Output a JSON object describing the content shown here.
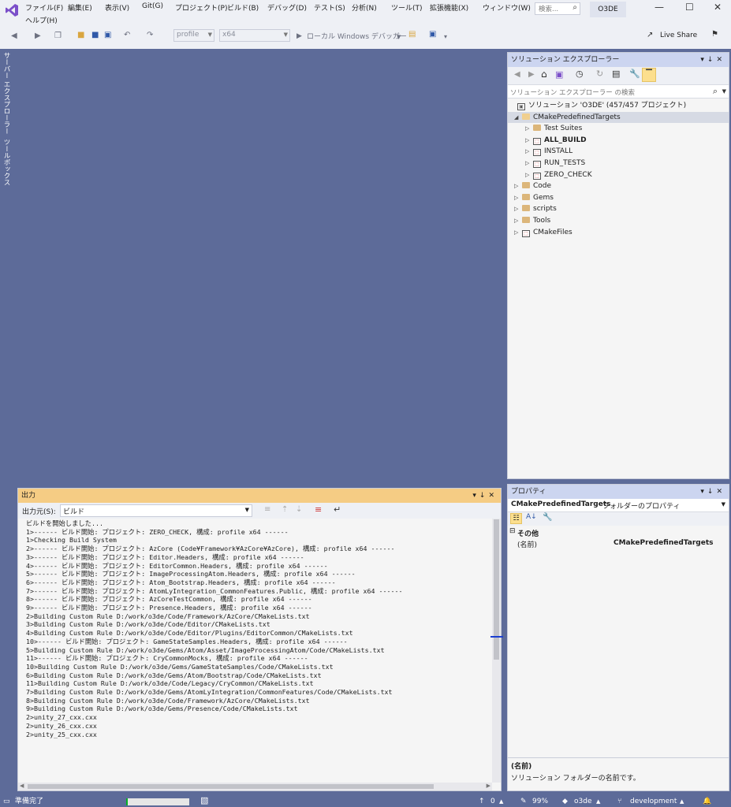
{
  "menu": [
    "ファイル(F)",
    "編集(E)",
    "表示(V)",
    "Git(G)",
    "プロジェクト(P)",
    "ビルド(B)",
    "デバッグ(D)",
    "テスト(S)",
    "分析(N)",
    "ツール(T)",
    "拡張機能(X)",
    "ウィンドウ(W)",
    "ヘルプ(H)"
  ],
  "search_placeholder": "検索...",
  "solution_badge": "O3DE",
  "toolbar": {
    "config": "profile",
    "platform": "x64",
    "run_label": "ローカル Windows デバッガー",
    "live_share": "Live Share"
  },
  "side_tabs": "サーバー エクスプローラー  ツールボックス",
  "solution_explorer": {
    "title": "ソリューション エクスプローラー",
    "search_placeholder": "ソリューション エクスプローラー の検索",
    "root": "ソリューション 'O3DE' (457/457 プロジェクト)",
    "items": [
      {
        "label": "CMakePredefinedTargets",
        "level": 1,
        "kind": "folder",
        "expanded": true,
        "selected": true
      },
      {
        "label": "Test Suites",
        "level": 2,
        "kind": "folder"
      },
      {
        "label": "ALL_BUILD",
        "level": 2,
        "kind": "project",
        "bold": true
      },
      {
        "label": "INSTALL",
        "level": 2,
        "kind": "project"
      },
      {
        "label": "RUN_TESTS",
        "level": 2,
        "kind": "project"
      },
      {
        "label": "ZERO_CHECK",
        "level": 2,
        "kind": "project"
      },
      {
        "label": "Code",
        "level": 1,
        "kind": "folder"
      },
      {
        "label": "Gems",
        "level": 1,
        "kind": "folder"
      },
      {
        "label": "scripts",
        "level": 1,
        "kind": "folder"
      },
      {
        "label": "Tools",
        "level": 1,
        "kind": "folder"
      },
      {
        "label": "CMakeFiles",
        "level": 1,
        "kind": "project"
      }
    ]
  },
  "output": {
    "title": "出力",
    "source_label": "出力元(S):",
    "source_value": "ビルド",
    "lines": [
      "ビルドを開始しました...",
      "1>------ ビルド開始: プロジェクト: ZERO_CHECK, 構成: profile x64 ------",
      "1>Checking Build System",
      "2>------ ビルド開始: プロジェクト: AzCore (Code¥Framework¥AzCore¥AzCore), 構成: profile x64 ------",
      "3>------ ビルド開始: プロジェクト: Editor.Headers, 構成: profile x64 ------",
      "4>------ ビルド開始: プロジェクト: EditorCommon.Headers, 構成: profile x64 ------",
      "5>------ ビルド開始: プロジェクト: ImageProcessingAtom.Headers, 構成: profile x64 ------",
      "6>------ ビルド開始: プロジェクト: Atom_Bootstrap.Headers, 構成: profile x64 ------",
      "7>------ ビルド開始: プロジェクト: AtomLyIntegration_CommonFeatures.Public, 構成: profile x64 ------",
      "8>------ ビルド開始: プロジェクト: AzCoreTestCommon, 構成: profile x64 ------",
      "9>------ ビルド開始: プロジェクト: Presence.Headers, 構成: profile x64 ------",
      "2>Building Custom Rule D:/work/o3de/Code/Framework/AzCore/CMakeLists.txt",
      "3>Building Custom Rule D:/work/o3de/Code/Editor/CMakeLists.txt",
      "4>Building Custom Rule D:/work/o3de/Code/Editor/Plugins/EditorCommon/CMakeLists.txt",
      "10>------ ビルド開始: プロジェクト: GameStateSamples.Headers, 構成: profile x64 ------",
      "5>Building Custom Rule D:/work/o3de/Gems/Atom/Asset/ImageProcessingAtom/Code/CMakeLists.txt",
      "11>------ ビルド開始: プロジェクト: CryCommonMocks, 構成: profile x64 ------",
      "10>Building Custom Rule D:/work/o3de/Gems/GameStateSamples/Code/CMakeLists.txt",
      "6>Building Custom Rule D:/work/o3de/Gems/Atom/Bootstrap/Code/CMakeLists.txt",
      "11>Building Custom Rule D:/work/o3de/Code/Legacy/CryCommon/CMakeLists.txt",
      "7>Building Custom Rule D:/work/o3de/Gems/AtomLyIntegration/CommonFeatures/Code/CMakeLists.txt",
      "8>Building Custom Rule D:/work/o3de/Code/Framework/AzCore/CMakeLists.txt",
      "9>Building Custom Rule D:/work/o3de/Gems/Presence/Code/CMakeLists.txt",
      "2>unity_27_cxx.cxx",
      "2>unity_26_cxx.cxx",
      "2>unity_25_cxx.cxx"
    ]
  },
  "properties": {
    "title": "プロパティ",
    "object": "CMakePredefinedTargets",
    "object_type": "フォルダーのプロパティ",
    "category": "その他",
    "row_name": "(名前)",
    "row_value": "CMakePredefinedTargets",
    "desc_title": "(名前)",
    "desc_text": "ソリューション フォルダーの名前です。"
  },
  "status": {
    "ready": "準備完了",
    "up": "0",
    "zoom": "99%",
    "repo": "o3de",
    "branch": "development"
  }
}
